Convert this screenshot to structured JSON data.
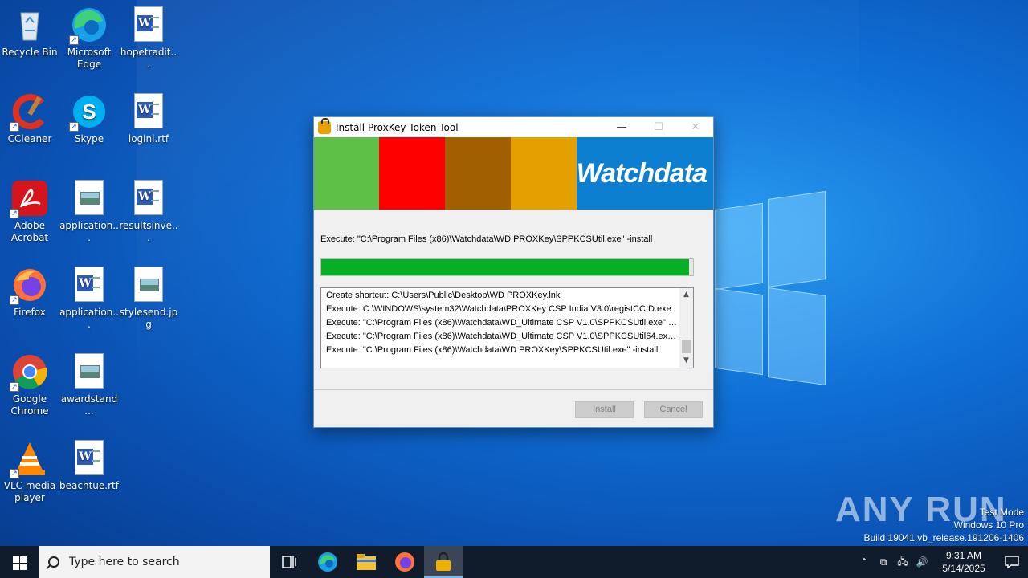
{
  "desktop": {
    "icons": [
      {
        "label": "Recycle Bin",
        "icon": "recycle-bin-icon"
      },
      {
        "label": "Microsoft Edge",
        "icon": "edge-icon"
      },
      {
        "label": "hopetradit...",
        "icon": "word-doc-icon"
      },
      {
        "label": "CCleaner",
        "icon": "ccleaner-icon"
      },
      {
        "label": "Skype",
        "icon": "skype-icon"
      },
      {
        "label": "logini.rtf",
        "icon": "word-doc-icon"
      },
      {
        "label": "Adobe Acrobat",
        "icon": "acrobat-icon"
      },
      {
        "label": "application...",
        "icon": "image-file-icon"
      },
      {
        "label": "resultsinve...",
        "icon": "word-doc-icon"
      },
      {
        "label": "Firefox",
        "icon": "firefox-icon"
      },
      {
        "label": "application...",
        "icon": "word-doc-icon"
      },
      {
        "label": "stylesend.jpg",
        "icon": "image-file-icon"
      },
      {
        "label": "Google Chrome",
        "icon": "chrome-icon"
      },
      {
        "label": "awardstand...",
        "icon": "image-file-icon"
      },
      {
        "label": "VLC media player",
        "icon": "vlc-icon"
      },
      {
        "label": "beachtue.rtf",
        "icon": "word-doc-icon"
      }
    ]
  },
  "dialog": {
    "title": "Install ProxKey Token Tool",
    "minimize_label": "—",
    "maximize_label": "☐",
    "close_label": "✕",
    "banner_brand": "Watchdata",
    "banner_colors": [
      "#5ec046",
      "#ff0000",
      "#a15f00",
      "#e5a000"
    ],
    "status_text": "Execute: \"C:\\Program Files (x86)\\Watchdata\\WD PROXKey\\SPPKCSUtil.exe\" -install",
    "progress_percent": 99,
    "log_lines": [
      "Create shortcut: C:\\Users\\Public\\Desktop\\WD PROXKey.lnk",
      "Execute: C:\\WINDOWS\\system32\\Watchdata\\PROXKey CSP India V3.0\\registCCID.exe",
      "Execute: \"C:\\Program Files (x86)\\Watchdata\\WD_Ultimate CSP V1.0\\SPPKCSUtil.exe\" -u...",
      "Execute: \"C:\\Program Files (x86)\\Watchdata\\WD_Ultimate CSP V1.0\\SPPKCSUtil64.exe\"...",
      "Execute: \"C:\\Program Files (x86)\\Watchdata\\WD PROXKey\\SPPKCSUtil.exe\" -install"
    ],
    "install_label": "Install",
    "cancel_label": "Cancel"
  },
  "watermark": {
    "text": "ANY RUN",
    "test_mode": "Test Mode",
    "edition": "Windows 10 Pro",
    "build": "Build 19041.vb_release.191206-1406"
  },
  "taskbar": {
    "search_placeholder": "Type here to search",
    "time": "9:31 AM",
    "date": "5/14/2025",
    "accent": "#7ab8f0"
  }
}
